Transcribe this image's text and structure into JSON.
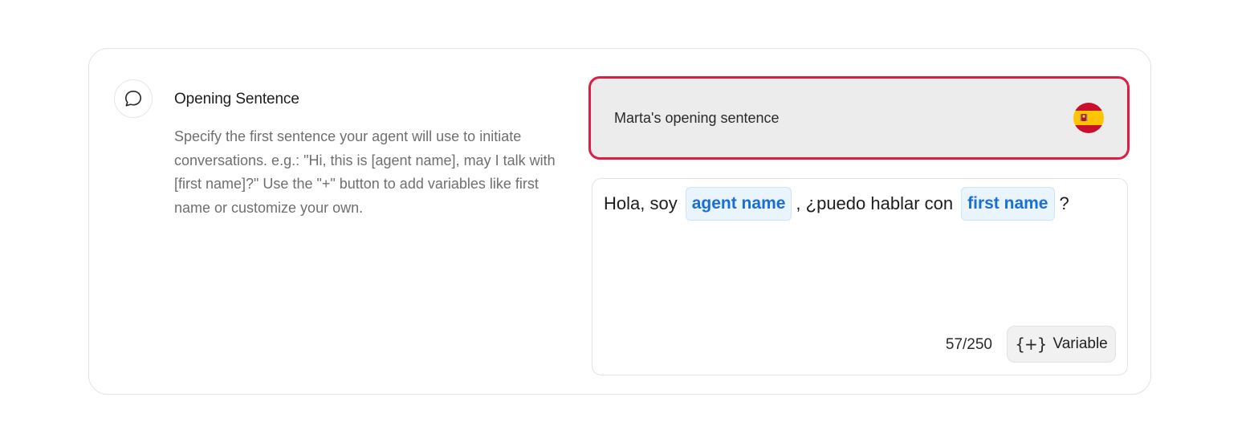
{
  "section": {
    "icon": "chat-bubble-icon",
    "title": "Opening Sentence",
    "description": "Specify the first sentence your agent will use to initiate conversations. e.g.: \"Hi, this is [agent name], may I talk with [first name]?\" Use the \"+\" button to add variables like first name or customize your own."
  },
  "language_select": {
    "label": "Marta's opening sentence",
    "flag_icon": "spain-flag-icon",
    "border_color": "#dc1e45"
  },
  "editor": {
    "segments": [
      {
        "type": "text",
        "value": "Hola, soy"
      },
      {
        "type": "variable",
        "value": "agent name"
      },
      {
        "type": "text",
        "value": ", ¿puedo hablar con"
      },
      {
        "type": "variable",
        "value": "first name"
      },
      {
        "type": "text",
        "value": "?"
      }
    ],
    "counter": "57/250",
    "variable_button": {
      "icon": "{+}",
      "label": "Variable"
    }
  },
  "colors": {
    "variable_chip_text": "#1a6ed8",
    "variable_chip_bg": "#eaf4fd"
  }
}
